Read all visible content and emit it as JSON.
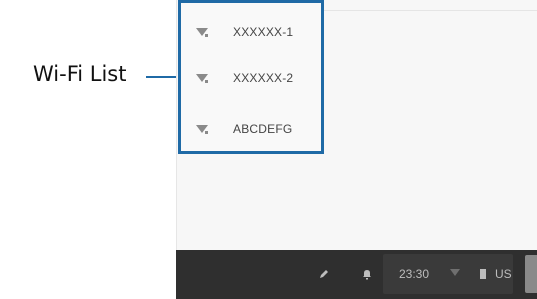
{
  "callout": {
    "label": "Wi-Fi List"
  },
  "wifi_networks": [
    {
      "ssid": "XXXXXX-1"
    },
    {
      "ssid": "XXXXXX-2"
    },
    {
      "ssid": "ABCDEFG"
    }
  ],
  "taskbar": {
    "time": "23:30",
    "locale": "US",
    "icons": [
      "pen-icon",
      "bell-icon",
      "wifi-icon",
      "battery-icon",
      "avatar"
    ]
  },
  "colors": {
    "callout_blue": "#1f6aa6",
    "taskbar": "#2f2f2f",
    "status_area": "#3a3a3a"
  }
}
